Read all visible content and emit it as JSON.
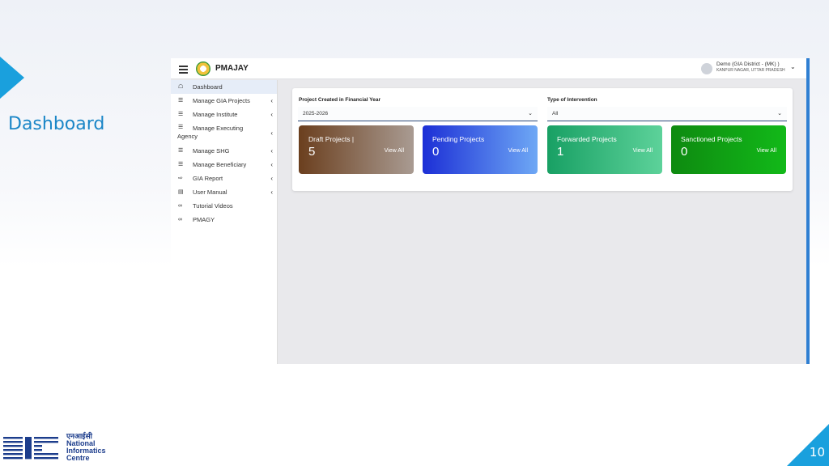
{
  "slide": {
    "title": "Dashboard",
    "page_number": "10",
    "accent_color": "#1aa0dd"
  },
  "org": {
    "hindi": "एनआईसी",
    "line1": "National",
    "line2": "Informatics",
    "line3": "Centre"
  },
  "header": {
    "brand": "PMAJAY",
    "user_name": "Demo (GIA District - (MK) )",
    "user_location": "KANPUR NAGAR, UTTAR PRADESH"
  },
  "sidebar": {
    "items": [
      {
        "label": "Dashboard",
        "icon": "home-icon",
        "has_submenu": false
      },
      {
        "label": "Manage GIA Projects",
        "icon": "list-icon",
        "has_submenu": true
      },
      {
        "label": "Manage Institute",
        "icon": "list-icon",
        "has_submenu": true
      },
      {
        "label": "Manage Executing",
        "label2": "Agency",
        "icon": "list-icon",
        "has_submenu": true
      },
      {
        "label": "Manage SHG",
        "icon": "list-icon",
        "has_submenu": true
      },
      {
        "label": "Manage Beneficiary",
        "icon": "list-icon",
        "has_submenu": true
      },
      {
        "label": "GIA Report",
        "icon": "report-icon",
        "has_submenu": true
      },
      {
        "label": "User Manual",
        "icon": "document-icon",
        "has_submenu": true
      },
      {
        "label": "Tutorial Videos",
        "icon": "link-icon",
        "has_submenu": false
      },
      {
        "label": "PMAGY",
        "icon": "link-icon",
        "has_submenu": false
      }
    ]
  },
  "filters": {
    "financial_year_label": "Project Created in Financial Year",
    "financial_year_value": "2025-2026",
    "intervention_label": "Type of Intervention",
    "intervention_value": "All"
  },
  "tiles": [
    {
      "title": "Draft Projects |",
      "count": "5",
      "link": "View All",
      "color": "#6b3f1e"
    },
    {
      "title": "Pending Projects",
      "count": "0",
      "link": "View All",
      "color": "#1c2fd6"
    },
    {
      "title": "Forwarded Projects",
      "count": "1",
      "link": "View All",
      "color": "#18a064"
    },
    {
      "title": "Sanctioned Projects",
      "count": "0",
      "link": "View All",
      "color": "#0e8a10"
    }
  ]
}
